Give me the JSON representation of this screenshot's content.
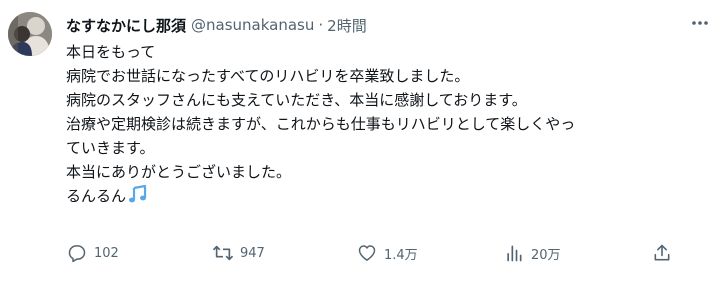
{
  "tweet": {
    "author_name": "なすなかにし那須",
    "handle": "@nasunakanasu",
    "separator": "·",
    "time": "2時間",
    "lines": [
      "本日をもって",
      "病院でお世話になったすべてのリハビリを卒業致しました。",
      "病院のスタッフさんにも支えていただき、本当に感謝しております。",
      "治療や定期検診は続きますが、これからも仕事もリハビリとして楽しくやっ",
      "ていきます。",
      "本当にありがとうございました。",
      "るんるん"
    ],
    "emoji_icon": "musical-notes-icon",
    "accent_color": "#1d9bf0",
    "muted_color": "#536471"
  },
  "actions": {
    "reply_count": "102",
    "retweet_count": "947",
    "like_count": "1.4万",
    "view_count": "20万"
  }
}
